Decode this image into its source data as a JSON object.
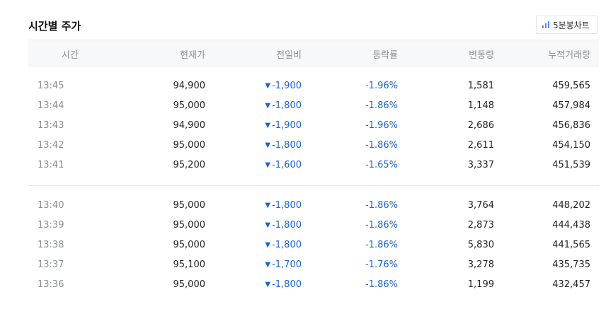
{
  "header": {
    "title": "시간별 주가",
    "chart_button_label": "5분봉차트"
  },
  "columns": [
    "시간",
    "현재가",
    "전일비",
    "등락률",
    "변동량",
    "누적거래량"
  ],
  "down_arrow": "▼",
  "groups": [
    [
      {
        "time": "13:45",
        "price": "94,900",
        "diff": "-1,900",
        "rate": "-1.96%",
        "vol": "1,581",
        "acc": "459,565"
      },
      {
        "time": "13:44",
        "price": "95,000",
        "diff": "-1,800",
        "rate": "-1.86%",
        "vol": "1,148",
        "acc": "457,984"
      },
      {
        "time": "13:43",
        "price": "94,900",
        "diff": "-1,900",
        "rate": "-1.96%",
        "vol": "2,686",
        "acc": "456,836"
      },
      {
        "time": "13:42",
        "price": "95,000",
        "diff": "-1,800",
        "rate": "-1.86%",
        "vol": "2,611",
        "acc": "454,150"
      },
      {
        "time": "13:41",
        "price": "95,200",
        "diff": "-1,600",
        "rate": "-1.65%",
        "vol": "3,337",
        "acc": "451,539"
      }
    ],
    [
      {
        "time": "13:40",
        "price": "95,000",
        "diff": "-1,800",
        "rate": "-1.86%",
        "vol": "3,764",
        "acc": "448,202"
      },
      {
        "time": "13:39",
        "price": "95,000",
        "diff": "-1,800",
        "rate": "-1.86%",
        "vol": "2,873",
        "acc": "444,438"
      },
      {
        "time": "13:38",
        "price": "95,000",
        "diff": "-1,800",
        "rate": "-1.86%",
        "vol": "5,830",
        "acc": "441,565"
      },
      {
        "time": "13:37",
        "price": "95,100",
        "diff": "-1,700",
        "rate": "-1.76%",
        "vol": "3,278",
        "acc": "435,735"
      },
      {
        "time": "13:36",
        "price": "95,000",
        "diff": "-1,800",
        "rate": "-1.86%",
        "vol": "1,199",
        "acc": "432,457"
      }
    ]
  ],
  "colors": {
    "down": "#1a62d6",
    "muted": "#8a8e94",
    "header_bg": "#f7f8fa"
  }
}
